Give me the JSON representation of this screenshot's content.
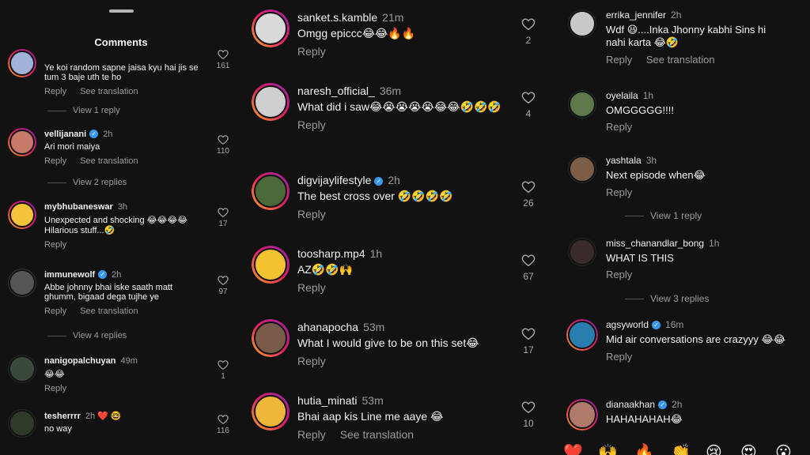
{
  "panel1": {
    "title": "Comments",
    "comments": [
      {
        "username": "",
        "time": "",
        "text": "Ye koi random sapne jaisa kyu hai jis se tum 3 baje uth te ho",
        "reply": "Reply",
        "translate": "See translation",
        "likes": "161",
        "view_replies": "View 1 reply",
        "avatar_color": "#9fb3d8"
      },
      {
        "username": "vellijanani",
        "time": "2h",
        "verified": true,
        "text": "Ari mori maiya",
        "reply": "Reply",
        "translate": "See translation",
        "likes": "110",
        "view_replies": "View 2 replies",
        "avatar_color": "#c77a6a"
      },
      {
        "username": "mybhubaneswar",
        "time": "3h",
        "text": "Unexpected and shocking 😂😂😂😂 Hilarious stuff...🤣",
        "reply": "Reply",
        "likes": "17",
        "avatar_color": "#f3c43a"
      },
      {
        "username": "immunewolf",
        "time": "2h",
        "verified": true,
        "text": "Abbe johnny bhai iske saath matt ghumm, bigaad dega tujhe ye",
        "reply": "Reply",
        "translate": "See translation",
        "likes": "97",
        "view_replies": "View 4 replies",
        "avatar_color": "#555555"
      },
      {
        "username": "nanigopalchuyan",
        "time": "49m",
        "text": "😂😂",
        "reply": "Reply",
        "likes": "1",
        "avatar_color": "#3a4a3a"
      },
      {
        "username": "tesherrrr",
        "time": "2h",
        "text": "no way",
        "reply": "",
        "likes": "116",
        "extra": "❤️ 🤓",
        "avatar_color": "#2e3b2a"
      }
    ]
  },
  "panel2": {
    "comments": [
      {
        "username": "sanket.s.kamble",
        "time": "21m",
        "text": "Omgg epiccc😂😂🔥🔥",
        "reply": "Reply",
        "likes": "2",
        "avatar_color": "#d9d9d9"
      },
      {
        "username": "naresh_official_",
        "time": "36m",
        "text": "What did i saw😂😭😭😭😭😂😂🤣🤣🤣",
        "reply": "Reply",
        "likes": "4",
        "avatar_color": "#cfcfcf"
      },
      {
        "username": "digvijaylifestyle",
        "time": "2h",
        "verified": true,
        "text": "The best cross over 🤣🤣🤣🤣",
        "reply": "Reply",
        "likes": "26",
        "avatar_color": "#4a6a3a"
      },
      {
        "username": "toosharp.mp4",
        "time": "1h",
        "text": "AZ🤣🤣🙌",
        "reply": "Reply",
        "likes": "67",
        "avatar_color": "#f2c230"
      },
      {
        "username": "ahanapocha",
        "time": "53m",
        "text": "What I would give to be on this set😂",
        "reply": "Reply",
        "likes": "17",
        "avatar_color": "#7a5a48"
      },
      {
        "username": "hutia_minati",
        "time": "53m",
        "text": "Bhai aap kis Line me aaye 😂",
        "reply": "Reply",
        "translate": "See translation",
        "likes": "10",
        "avatar_color": "#f0b63a"
      }
    ]
  },
  "panel3": {
    "comments": [
      {
        "username": "errika_jennifer",
        "time": "2h",
        "text": "Wdf 😆....Inka Jhonny kabhi Sins hi nahi karta 😂🤣",
        "reply": "Reply",
        "translate": "See translation",
        "avatar_color": "#c9c9c9"
      },
      {
        "username": "oyelaila",
        "time": "1h",
        "text": "OMGGGGG!!!!",
        "reply": "Reply",
        "avatar_color": "#5f7a4a"
      },
      {
        "username": "yashtala",
        "time": "3h",
        "text": "Next episode when😂",
        "reply": "Reply",
        "view_replies": "View 1 reply",
        "avatar_color": "#7b5e45"
      },
      {
        "username": "miss_chanandlar_bong",
        "time": "1h",
        "text": "WHAT IS THIS",
        "reply": "Reply",
        "view_replies": "View 3 replies",
        "avatar_color": "#3a2a2a"
      },
      {
        "username": "agsyworld",
        "time": "16m",
        "verified": true,
        "text": "Mid air conversations are crazyyy 😂😂",
        "reply": "Reply",
        "avatar_color": "#2a7fb0"
      },
      {
        "username": "dianaakhan",
        "time": "2h",
        "verified": true,
        "text": "HAHAHAHAH😂",
        "reply": "",
        "avatar_color": "#b07a6a"
      }
    ],
    "reactions": [
      "❤️",
      "🙌",
      "🔥",
      "👏",
      "😢",
      "😍",
      "😮"
    ]
  },
  "colors": {
    "background": "#121212",
    "story_ring": [
      "#f9a825",
      "#e91e63",
      "#8e24aa"
    ],
    "verified": "#3897f0",
    "muted_text": "#9b9b9b"
  }
}
